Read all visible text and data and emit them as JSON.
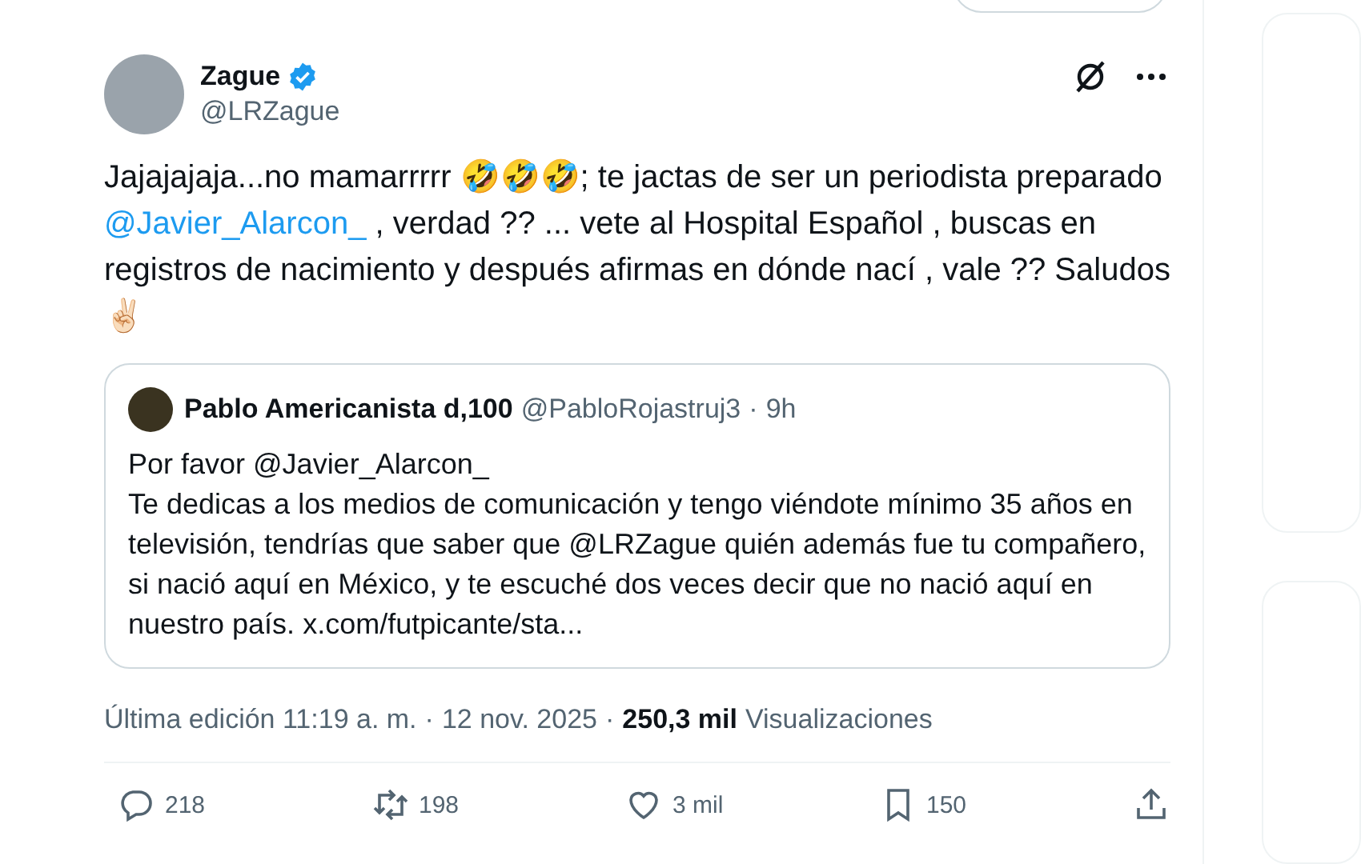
{
  "author": {
    "name": "Zague",
    "verified": true,
    "handle": "@LRZague"
  },
  "text": [
    {
      "kind": "text",
      "value": "Jajajajaja...no mamarrrrr 🤣🤣🤣; te jactas de ser un periodista preparado "
    },
    {
      "kind": "mention",
      "value": "@Javier_Alarcon_"
    },
    {
      "kind": "text",
      "value": " , verdad ?? ... vete al Hospital Español , buscas en registros de nacimiento y después afirmas en dónde nací , vale ?? Saludos ✌🏻"
    }
  ],
  "quote": {
    "name": "Pablo Americanista d,100",
    "handle": "@PabloRojastruj3",
    "separator": "·",
    "time": "9h",
    "lines": [
      "Por favor @Javier_Alarcon_",
      "Te dedicas a los medios de comunicación y tengo viéndote mínimo 35 años en televisión, tendrías que saber que @LRZague quién además fue tu compañero, si nació aquí en México, y te escuché dos veces decir que no nació aquí en nuestro país. x.com/futpicante/sta..."
    ]
  },
  "meta": {
    "separator": "·",
    "edited": "Última edición 11:19 a. m.",
    "date": "12 nov. 2025",
    "views_count": "250,3 mil",
    "views_label": "Visualizaciones"
  },
  "actions": [
    {
      "kind": "reply",
      "count": "218"
    },
    {
      "kind": "repost",
      "count": "198"
    },
    {
      "kind": "like",
      "count": "3 mil"
    },
    {
      "kind": "bookmark",
      "count": "150"
    },
    {
      "kind": "share"
    }
  ]
}
